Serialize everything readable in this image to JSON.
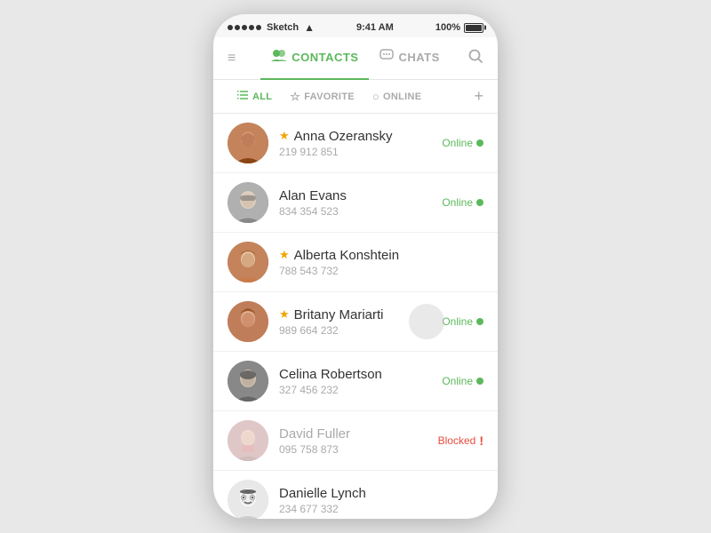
{
  "statusBar": {
    "dots": [
      "dot",
      "dot",
      "dot",
      "dot",
      "dot"
    ],
    "appName": "Sketch",
    "wifi": "WiFi",
    "time": "9:41 AM",
    "battery": "100%"
  },
  "nav": {
    "contacts_label": "CONTACTS",
    "chats_label": "CHATS",
    "hamburger_icon": "≡",
    "search_icon": "⌕"
  },
  "subNav": {
    "all_label": "ALL",
    "favorite_label": "FAVORITE",
    "online_label": "ONLINE",
    "add_icon": "+"
  },
  "contacts": [
    {
      "id": "anna",
      "name": "Anna Ozeransky",
      "phone": "219 912 851",
      "starred": true,
      "status": "online",
      "blocked": false,
      "avatarType": "anna"
    },
    {
      "id": "alan",
      "name": "Alan Evans",
      "phone": "834 354 523",
      "starred": false,
      "status": "online",
      "blocked": false,
      "avatarType": "alan"
    },
    {
      "id": "alberta",
      "name": "Alberta Konshtein",
      "phone": "788 543 732",
      "starred": true,
      "status": null,
      "blocked": false,
      "avatarType": "alberta"
    },
    {
      "id": "britany",
      "name": "Britany Mariarti",
      "phone": "989 664 232",
      "starred": true,
      "status": "online",
      "blocked": false,
      "avatarType": "britany",
      "hasRipple": true
    },
    {
      "id": "celina",
      "name": "Celina Robertson",
      "phone": "327 456 232",
      "starred": false,
      "status": "online",
      "blocked": false,
      "avatarType": "celina"
    },
    {
      "id": "david",
      "name": "David Fuller",
      "phone": "095 758 873",
      "starred": false,
      "status": null,
      "blocked": true,
      "avatarType": "david"
    },
    {
      "id": "danielle",
      "name": "Danielle Lynch",
      "phone": "234 677 332",
      "starred": false,
      "status": null,
      "blocked": false,
      "avatarType": "danielle"
    }
  ],
  "labels": {
    "online": "Online",
    "blocked": "Blocked",
    "star": "★",
    "star_empty": "☆"
  }
}
